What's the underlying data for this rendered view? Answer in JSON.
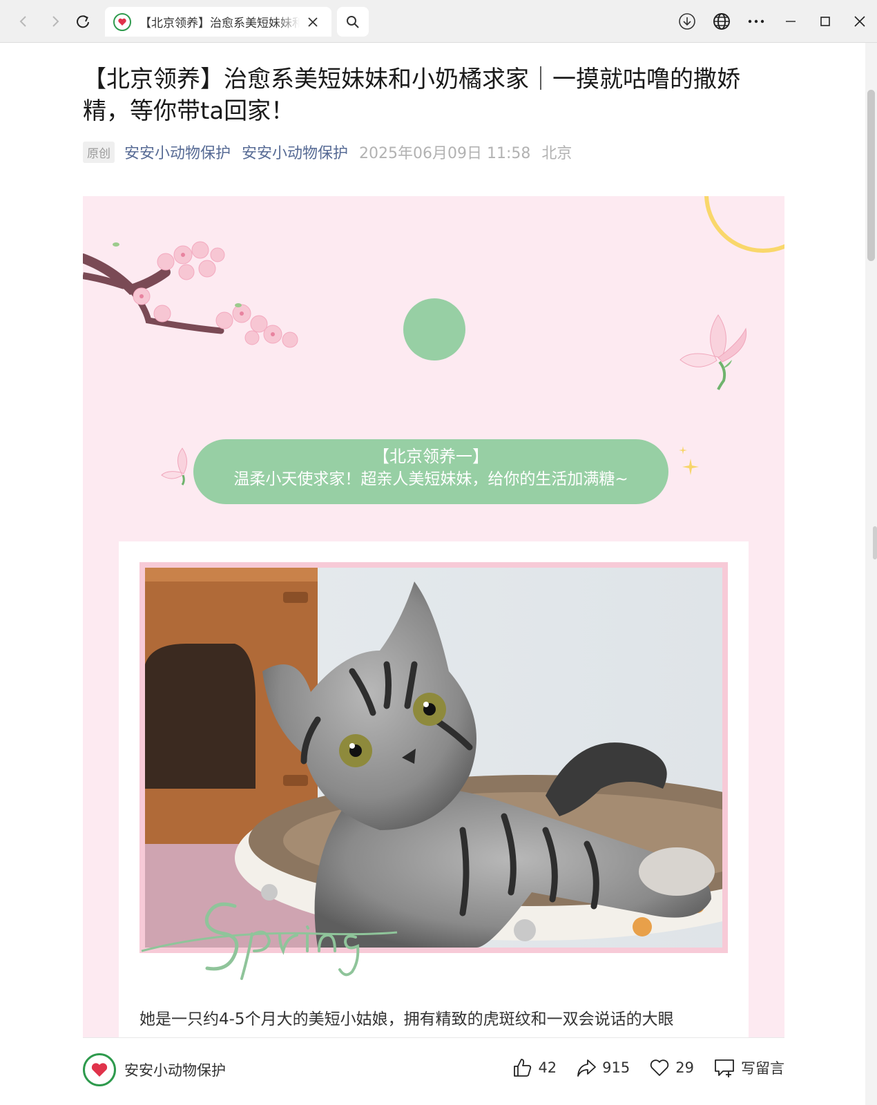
{
  "browser": {
    "tab_title": "【北京领养】治愈系美短妹妹和小奶橘求家",
    "icons": {
      "back": "back-arrow-icon",
      "forward": "forward-arrow-icon",
      "refresh": "refresh-icon",
      "close_tab": "close-icon",
      "search": "search-icon",
      "download": "download-icon",
      "translate": "globe-icon",
      "more": "more-icon",
      "minimize": "minimize-icon",
      "maximize": "maximize-icon",
      "close_window": "close-icon"
    }
  },
  "article": {
    "title": "【北京领养】治愈系美短妹妹和小奶橘求家｜一摸就咕噜的撒娇精，等你带ta回家！",
    "badge": "原创",
    "author": "安安小动物保护",
    "account": "安安小动物保护",
    "date": "2025年06月09日 11:58",
    "location": "北京"
  },
  "poster": {
    "banner_line1": "【北京领养一】",
    "banner_line2": "温柔小天使求家！超亲人美短妹妹，给你的生活加满糖~",
    "script_word": "Spring",
    "description": "她是一只约4-5个月大的美短小姑娘，拥有精致的虎斑纹和一双会说话的大眼",
    "colors": {
      "background": "#fdeaf1",
      "accent_green": "#97cfa4",
      "frame_pink": "#f7cad7",
      "ring_yellow": "#f9d76b"
    }
  },
  "bottom_bar": {
    "account_name": "安安小动物保护",
    "likes": "42",
    "shares": "915",
    "favorites": "29",
    "comment_label": "写留言"
  }
}
